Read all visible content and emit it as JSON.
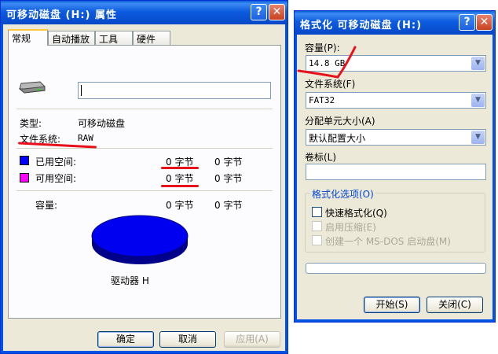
{
  "props": {
    "title": "可移动磁盘 (H:) 属性",
    "tabs": [
      "常规",
      "自动播放",
      "工具",
      "硬件"
    ],
    "name_value": "",
    "type_label": "类型:",
    "type_value": "可移动磁盘",
    "fs_label": "文件系统:",
    "fs_value": "RAW",
    "used_label": "已用空间:",
    "used_bytes": "0 字节",
    "used_size": "0 字节",
    "free_label": "可用空间:",
    "free_bytes": "0 字节",
    "free_size": "0 字节",
    "cap_label": "容量:",
    "cap_bytes": "0 字节",
    "cap_size": "0 字节",
    "drive_label": "驱动器 H",
    "ok": "确定",
    "cancel": "取消",
    "apply": "应用(A)",
    "colors": {
      "used": "#0000ff",
      "free": "#ff00ff",
      "pie": "#0000f0"
    }
  },
  "format": {
    "title": "格式化 可移动磁盘 (H:)",
    "capacity_label": "容量(P):",
    "capacity_value": "14.8 GB",
    "fs_label": "文件系统(F)",
    "fs_value": "FAT32",
    "alloc_label": "分配单元大小(A)",
    "alloc_value": "默认配置大小",
    "volume_label": "卷标(L)",
    "volume_value": "",
    "options_title": "格式化选项(O)",
    "opt_quick": "快速格式化(Q)",
    "opt_compress": "启用压缩(E)",
    "opt_msdos": "创建一个 MS-DOS 启动盘(M)",
    "progress": 0,
    "start": "开始(S)",
    "close": "关闭(C)"
  }
}
